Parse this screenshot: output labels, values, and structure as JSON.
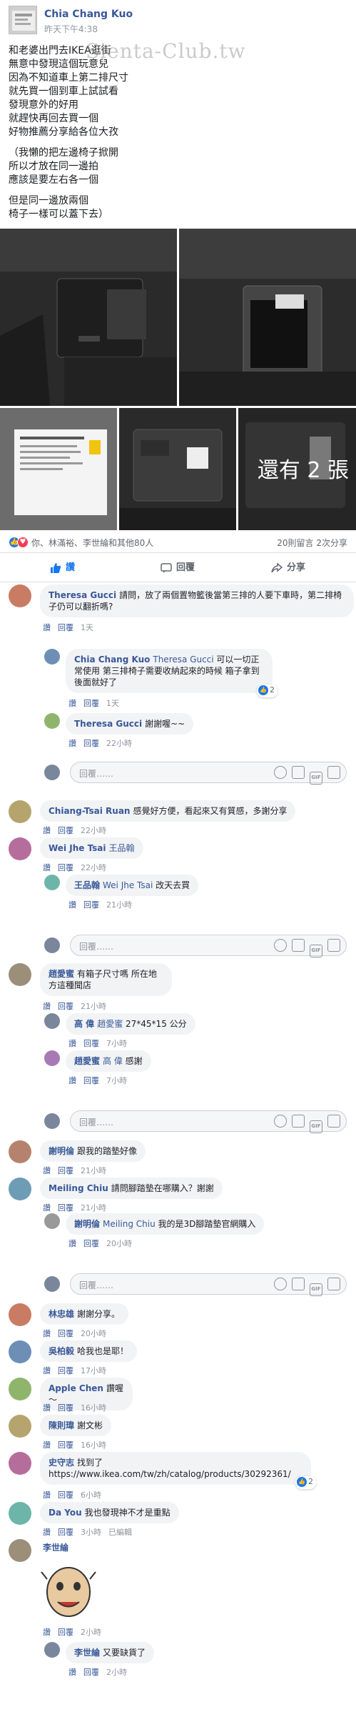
{
  "post": {
    "author": "Chia Chang Kuo",
    "time": "昨天下午4:38",
    "watermark": "Sienta-Club.tw",
    "lines": [
      "和老婆出門去IKEA逛街",
      "無意中發現這個玩意兒",
      "因為不知道車上第二排尺寸",
      "就先買一個到車上試試看",
      "發現意外的好用",
      "就趕快再回去買一個",
      "好物推薦分享給各位大孜",
      "",
      "（我懶的把左邊椅子掀開",
      "所以才放在同一邊拍",
      "應該是要左右各一個",
      "",
      "但是同一邊放兩個",
      "椅子一樣可以蓋下去）"
    ],
    "more_photos": "還有 2 張"
  },
  "stats": {
    "names": "你、林滿裕、李世綸和其他80人",
    "comments_shares": "20則留言 2次分享"
  },
  "actions": {
    "like": "讚",
    "comment": "回覆",
    "share": "分享"
  },
  "common": {
    "like": "讚",
    "reply": "回覆",
    "reply_placeholder": "回覆……",
    "gif": "GIF"
  },
  "comments": [
    {
      "name": "Theresa Gucci",
      "text": "請問，放了兩個置物籃後當第三排的人要下車時，第二排椅子仍可以翻折嗎?",
      "time": "1天"
    },
    {
      "name": "Chia Chang Kuo",
      "tag": "Theresa Gucci",
      "text": "可以一切正常使用 第三排椅子需要收納起來的時候 箱子拿到後面就好了",
      "time": "1天",
      "reactions": "2"
    },
    {
      "name": "Theresa Gucci",
      "text": "謝謝喔~~",
      "time": "22小時"
    },
    {
      "name": "Chiang-Tsai Ruan",
      "text": "感覺好方便，看起來又有質感，多謝分享",
      "time": "22小時"
    },
    {
      "name": "Wei Jhe Tsai",
      "tag": "王品翰",
      "text": "",
      "time": "22小時"
    },
    {
      "name": "王品翰",
      "tag": "Wei Jhe Tsai",
      "text": "改天去買",
      "time": "21小時"
    },
    {
      "name": "趙愛蜜",
      "text": "有箱子尺寸嗎 所在地方這種聞店",
      "time": "21小時"
    },
    {
      "name": "高 偉",
      "tag": "趙愛蜜",
      "text": "27*45*15 公分",
      "time": "7小時"
    },
    {
      "name": "趙愛蜜",
      "tag": "高 偉",
      "text": "感謝",
      "time": "7小時"
    },
    {
      "name": "謝明倫",
      "text": "跟我的踏墊好像",
      "time": "21小時"
    },
    {
      "name": "Meiling Chiu",
      "text": "請問腳踏墊在哪購入？謝謝",
      "time": "21小時"
    },
    {
      "name": "謝明倫",
      "tag": "Meiling Chiu",
      "text": "我的是3D腳踏墊官網購入",
      "time": "20小時"
    },
    {
      "name": "林忠雄",
      "text": "謝謝分享。",
      "time": "20小時"
    },
    {
      "name": "吳柏毅",
      "text": "哈我也是耶！",
      "time": "17小時"
    },
    {
      "name": "Apple Chen",
      "text": "讚喔～",
      "time": "16小時"
    },
    {
      "name": "陳則瑋",
      "text": "謝文彬",
      "time": "16小時"
    },
    {
      "name": "史守志",
      "text": "找到了 https://www.ikea.com/tw/zh/catalog/products/30292361/",
      "time": "6小時",
      "reactions": "2"
    },
    {
      "name": "Da You",
      "text": "我也發現神不才是重點",
      "time": "3小時",
      "edited": "已編輯"
    },
    {
      "name": "李世綸",
      "text": "",
      "time": "2小時"
    },
    {
      "name": "李世綸",
      "text": "又要缺貨了",
      "time": "2小時"
    }
  ],
  "colors": {
    "link": "#385898",
    "meta": "#90949c",
    "bubble": "#f2f3f5",
    "like_blue": "#1877f2"
  }
}
